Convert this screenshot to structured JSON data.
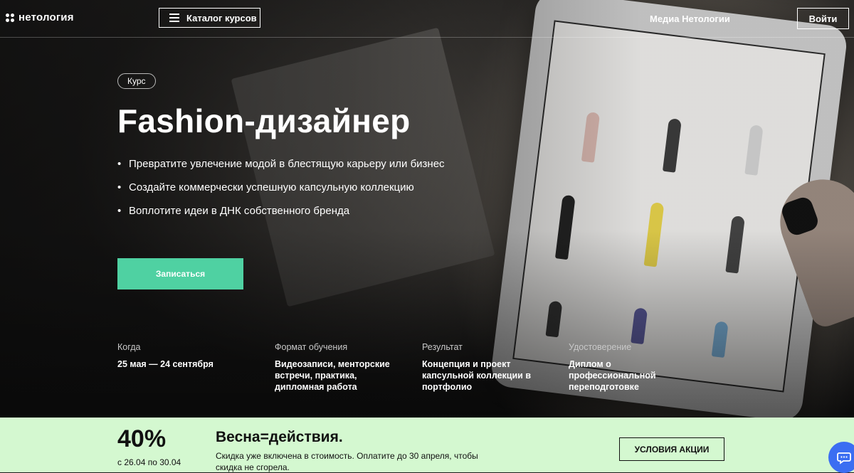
{
  "header": {
    "logo": "нетология",
    "catalog_label": "Каталог курсов",
    "media_label": "Медиа Нетологии",
    "login_label": "Войти"
  },
  "hero": {
    "badge": "Курс",
    "title": "Fashion-дизайнер",
    "bullets": [
      "Превратите увлечение модой в блестящую карьеру или бизнес",
      "Создайте коммерчески успешную капсульную коллекцию",
      "Воплотите идеи в ДНК собственного бренда"
    ],
    "cta_label": "Записаться"
  },
  "facts": [
    {
      "label": "Когда",
      "value": "25 мая — 24 сентября"
    },
    {
      "label": "Формат обучения",
      "value": "Видеозаписи, менторские встречи, практика, дипломная работа"
    },
    {
      "label": "Результат",
      "value": "Концепция и проект капсульной коллекции в портфолио"
    },
    {
      "label": "Удостоверение",
      "value": "Диплом о профессиональной переподготовке"
    }
  ],
  "promo": {
    "discount": "40%",
    "dates": "с 26.04 по 30.04",
    "title": "Весна=действия.",
    "description": "Скидка уже включена в стоимость. Оплатите до 30 апреля, чтобы скидка не сгорела.",
    "button_label": "УСЛОВИЯ АКЦИИ"
  },
  "colors": {
    "accent": "#4fd1a2",
    "promo_bg": "#d4f8d0",
    "chat": "#3b6ef2"
  },
  "icons": [
    "logo-icon",
    "menu-icon",
    "chat-icon"
  ]
}
